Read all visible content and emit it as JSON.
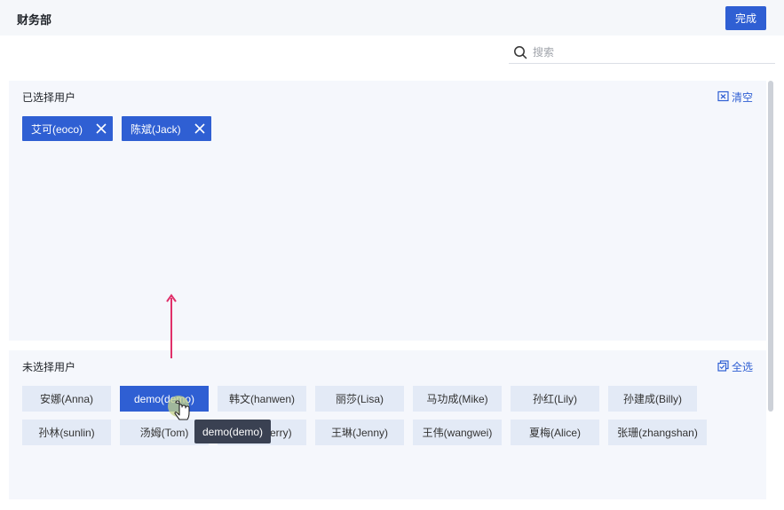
{
  "header": {
    "title": "财务部",
    "done_label": "完成"
  },
  "search": {
    "placeholder": "搜索",
    "value": ""
  },
  "selected_panel": {
    "title": "已选择用户",
    "clear_label": "清空",
    "chips": [
      {
        "label": "艾可(eoco)"
      },
      {
        "label": "陈斌(Jack)"
      }
    ]
  },
  "unselected_panel": {
    "title": "未选择用户",
    "select_all_label": "全选",
    "users": [
      {
        "label": "安娜(Anna)"
      },
      {
        "label": "demo(demo)",
        "state": "hovered"
      },
      {
        "label": "韩文(hanwen)"
      },
      {
        "label": "丽莎(Lisa)"
      },
      {
        "label": "马功成(Mike)"
      },
      {
        "label": "孙红(Lily)"
      },
      {
        "label": "孙建成(Billy)"
      },
      {
        "label": "孙林(sunlin)"
      },
      {
        "label": "汤姆(Tom)"
      },
      {
        "label": "雪莉(Sherry)"
      },
      {
        "label": "王琳(Jenny)"
      },
      {
        "label": "王伟(wangwei)"
      },
      {
        "label": "夏梅(Alice)"
      },
      {
        "label": "张珊(zhangshan)"
      }
    ]
  },
  "tooltip": {
    "text": "demo(demo)"
  },
  "colors": {
    "accent": "#2f5fd3",
    "panel_bg": "#f5f7fc",
    "user_bg": "#e3eaf6",
    "arrow": "#e0306a"
  }
}
